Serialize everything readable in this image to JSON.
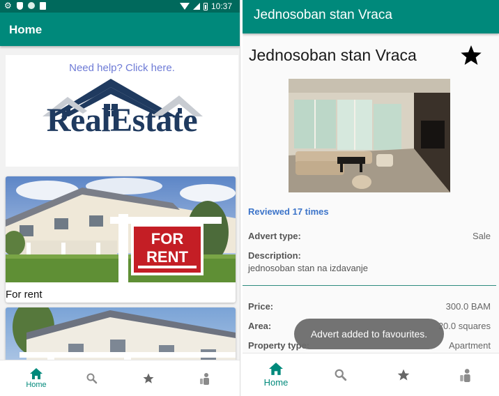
{
  "status_bar": {
    "time": "10:37"
  },
  "left": {
    "appbar": {
      "title": "Home"
    },
    "banner": {
      "help_link": "Need help? Click here.",
      "logo_text": "RealEstate"
    },
    "listings": [
      {
        "caption": "For rent",
        "sign_lines": [
          "FOR",
          "RENT"
        ]
      },
      {
        "caption": ""
      }
    ],
    "bottom_nav": [
      {
        "icon": "home-icon",
        "label": "Home",
        "active": true
      },
      {
        "icon": "search-icon",
        "label": ""
      },
      {
        "icon": "star-icon",
        "label": ""
      },
      {
        "icon": "person-icon",
        "label": ""
      }
    ]
  },
  "right": {
    "appbar": {
      "title": "Jednosoban stan Vraca"
    },
    "title": "Jednosoban stan Vraca",
    "reviewed": "Reviewed 17 times",
    "advert_type": {
      "label": "Advert type:",
      "value": "Sale"
    },
    "description": {
      "label": "Description:",
      "value": "jednosoban stan na izdavanje"
    },
    "price": {
      "label": "Price:",
      "value": "300.0 BAM"
    },
    "area": {
      "label": "Area:",
      "value": "20.0 squares"
    },
    "property_type": {
      "label": "Property type:",
      "value": "Apartment"
    },
    "toast": "Advert added to favourites.",
    "bottom_nav": [
      {
        "icon": "home-icon",
        "label": "Home",
        "active": true
      },
      {
        "icon": "search-icon",
        "label": ""
      },
      {
        "icon": "star-icon",
        "label": ""
      },
      {
        "icon": "person-icon",
        "label": ""
      }
    ]
  },
  "colors": {
    "primary": "#00897b",
    "primary_dark": "#00695c",
    "link": "#6e7bd6",
    "reviewed": "#3c74c9",
    "logo_navy": "#1f3a5f",
    "toast": "#6c6c6c"
  }
}
